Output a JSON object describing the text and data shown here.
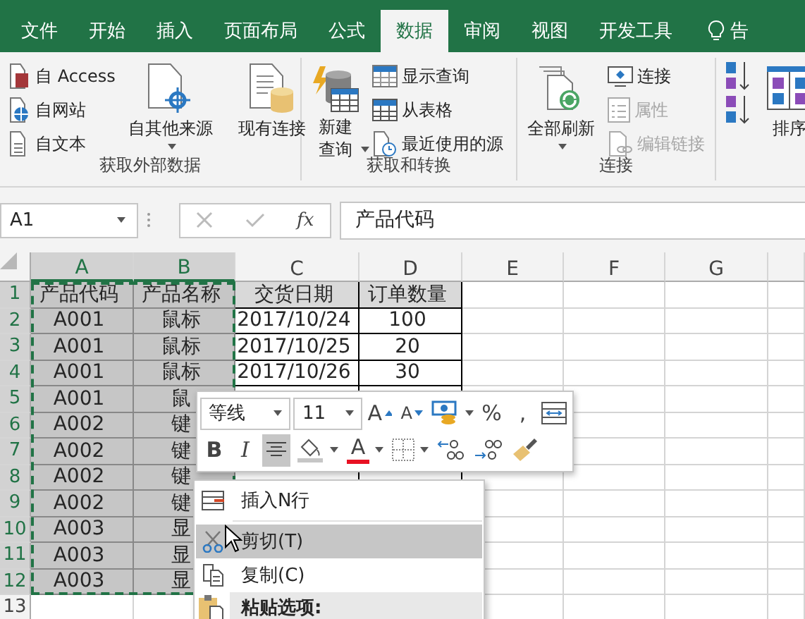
{
  "tabs": [
    {
      "label": "文件",
      "selected": false
    },
    {
      "label": "开始",
      "selected": false
    },
    {
      "label": "插入",
      "selected": false
    },
    {
      "label": "页面布局",
      "selected": false
    },
    {
      "label": "公式",
      "selected": false
    },
    {
      "label": "数据",
      "selected": true
    },
    {
      "label": "审阅",
      "selected": false
    },
    {
      "label": "视图",
      "selected": false
    },
    {
      "label": "开发工具",
      "selected": false
    }
  ],
  "tell_me": "告",
  "ribbon": {
    "groups": [
      {
        "label": "获取外部数据",
        "items": [
          {
            "kind": "small",
            "label": "自 Access",
            "disabled": false
          },
          {
            "kind": "small",
            "label": "自网站",
            "disabled": false
          },
          {
            "kind": "small",
            "label": "自文本",
            "disabled": false
          },
          {
            "kind": "large",
            "label": "自其他来源",
            "caret": true
          },
          {
            "kind": "large",
            "label": "现有连接",
            "caret": false
          }
        ]
      },
      {
        "label": "获取和转换",
        "items": [
          {
            "kind": "tall",
            "label": "新建查询",
            "caret": true
          },
          {
            "kind": "small",
            "label": "显示查询",
            "disabled": false
          },
          {
            "kind": "small",
            "label": "从表格",
            "disabled": false
          },
          {
            "kind": "small",
            "label": "最近使用的源",
            "disabled": false
          }
        ]
      },
      {
        "label": "连接",
        "items": [
          {
            "kind": "large",
            "label": "全部刷新",
            "caret": true
          },
          {
            "kind": "small",
            "label": "连接",
            "disabled": false
          },
          {
            "kind": "small",
            "label": "属性",
            "disabled": true
          },
          {
            "kind": "small",
            "label": "编辑链接",
            "disabled": true
          }
        ]
      },
      {
        "items": [
          {
            "kind": "icon"
          },
          {
            "kind": "icon"
          },
          {
            "kind": "large",
            "label": "排序",
            "caret": false
          }
        ]
      }
    ]
  },
  "formula_bar": {
    "name_box": "A1",
    "function_label": "fx",
    "value": "产品代码"
  },
  "sheet": {
    "columns": [
      {
        "label": "A",
        "selected": true
      },
      {
        "label": "B",
        "selected": true
      },
      {
        "label": "C",
        "selected": false
      },
      {
        "label": "D",
        "selected": false
      },
      {
        "label": "E",
        "selected": false
      },
      {
        "label": "F",
        "selected": false
      },
      {
        "label": "G",
        "selected": false
      }
    ],
    "rows": [
      {
        "number": "1",
        "selected": true,
        "kind": "header",
        "cells": [
          "产品代码",
          "产品名称",
          "交货日期",
          "订单数量"
        ]
      },
      {
        "number": "2",
        "selected": true,
        "kind": "data",
        "cells": [
          "A001",
          "鼠标",
          "2017/10/24",
          "100"
        ]
      },
      {
        "number": "3",
        "selected": true,
        "kind": "data",
        "cells": [
          "A001",
          "鼠标",
          "2017/10/25",
          "20"
        ]
      },
      {
        "number": "4",
        "selected": true,
        "kind": "data",
        "cells": [
          "A001",
          "鼠标",
          "2017/10/26",
          "30"
        ]
      },
      {
        "number": "5",
        "selected": true,
        "kind": "data",
        "cells": [
          "A001",
          "鼠"
        ]
      },
      {
        "number": "6",
        "selected": true,
        "kind": "data",
        "cells": [
          "A002",
          "键"
        ]
      },
      {
        "number": "7",
        "selected": true,
        "kind": "data",
        "cells": [
          "A002",
          "键"
        ]
      },
      {
        "number": "8",
        "selected": true,
        "kind": "data",
        "cells": [
          "A002",
          "键"
        ]
      },
      {
        "number": "9",
        "selected": true,
        "kind": "data",
        "cells": [
          "A002",
          "键"
        ]
      },
      {
        "number": "10",
        "selected": true,
        "kind": "data",
        "cells": [
          "A003",
          "显"
        ]
      },
      {
        "number": "11",
        "selected": true,
        "kind": "data",
        "cells": [
          "A003",
          "显"
        ]
      },
      {
        "number": "12",
        "selected": true,
        "kind": "data",
        "cells": [
          "A003",
          "显"
        ]
      },
      {
        "number": "13",
        "selected": false,
        "kind": "data",
        "cells": []
      }
    ]
  },
  "mini_toolbar": {
    "font": "等线",
    "size": "11",
    "row1": [
      {
        "kind": "grow",
        "label": "A"
      },
      {
        "kind": "shrink",
        "label": "A"
      },
      {
        "kind": "accounting"
      },
      {
        "kind": "text",
        "label": "%"
      },
      {
        "kind": "text",
        "label": ","
      },
      {
        "kind": "wrap"
      }
    ],
    "row2": [
      {
        "kind": "bold",
        "label": "B",
        "selected": false
      },
      {
        "kind": "italic",
        "label": "I",
        "selected": false
      },
      {
        "kind": "center",
        "selected": true
      },
      {
        "kind": "fill"
      },
      {
        "kind": "fontcolor",
        "label": "A"
      },
      {
        "kind": "borders"
      },
      {
        "kind": "decrease-decimal"
      },
      {
        "kind": "increase-decimal"
      },
      {
        "kind": "painter"
      }
    ]
  },
  "context_menu": {
    "items": [
      {
        "kind": "insert",
        "label": "插入N行",
        "selected": false
      },
      {
        "kind": "separator"
      },
      {
        "kind": "cut",
        "label": "剪切(T)",
        "selected": true
      },
      {
        "kind": "copy",
        "label": "复制(C)",
        "selected": false
      },
      {
        "kind": "heading",
        "label": "粘贴选项:"
      }
    ]
  }
}
